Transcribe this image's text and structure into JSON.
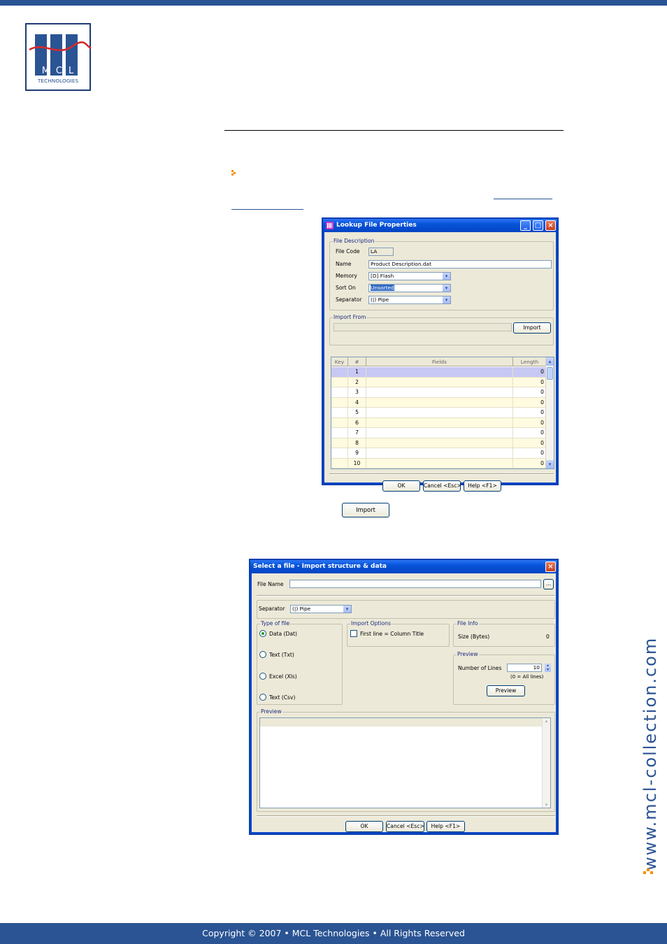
{
  "logo": {
    "letters": "MCL",
    "subtitle": "TECHNOLOGIES"
  },
  "side_url": "www.mcl-collection.com",
  "footer": {
    "text": "Copyright © 2007 • MCL Technologies • All Rights Reserved"
  },
  "inline_import_button": "Import",
  "lookup_dialog": {
    "title": "Lookup File Properties",
    "file_description_legend": "File Description",
    "labels": {
      "file_code": "File Code",
      "name": "Name",
      "memory": "Memory",
      "sort_on": "Sort On",
      "separator": "Separator"
    },
    "values": {
      "file_code": "LA",
      "name": "Product Description.dat",
      "memory": "[D] Flash",
      "sort_on": "Unsorted",
      "separator": "(|) Pipe"
    },
    "import_from_legend": "Import From",
    "import_button": "Import",
    "grid": {
      "columns": [
        "Key",
        "#",
        "Fields",
        "Length"
      ],
      "rows": [
        {
          "num": "1",
          "field": "",
          "length": "0"
        },
        {
          "num": "2",
          "field": "",
          "length": "0"
        },
        {
          "num": "3",
          "field": "",
          "length": "0"
        },
        {
          "num": "4",
          "field": "",
          "length": "0"
        },
        {
          "num": "5",
          "field": "",
          "length": "0"
        },
        {
          "num": "6",
          "field": "",
          "length": "0"
        },
        {
          "num": "7",
          "field": "",
          "length": "0"
        },
        {
          "num": "8",
          "field": "",
          "length": "0"
        },
        {
          "num": "9",
          "field": "",
          "length": "0"
        },
        {
          "num": "10",
          "field": "",
          "length": "0"
        }
      ]
    },
    "buttons": {
      "ok": "OK",
      "cancel": "Cancel <Esc>",
      "help": "Help <F1>"
    }
  },
  "select_dialog": {
    "title": "Select a file - Import structure & data",
    "file_name_label": "File Name",
    "browse_button": "...",
    "separator_label": "Separator",
    "separator_value": "(|) Pipe",
    "type_of_file_legend": "Type of file",
    "type_options": [
      "Data (Dat)",
      "Text (Txt)",
      "Excel (Xls)",
      "Text (Csv)"
    ],
    "import_options_legend": "Import Options",
    "first_line_label": "First line = Column Title",
    "file_info_legend": "File Info",
    "size_label": "Size (Bytes)",
    "size_value": "0",
    "preview_legend": "Preview",
    "number_of_lines_label": "Number of Lines",
    "number_of_lines_value": "10",
    "all_lines_hint": "(0 = All lines)",
    "preview_button": "Preview",
    "preview_area_legend": "Preview",
    "buttons": {
      "ok": "OK",
      "cancel": "Cancel <Esc>",
      "help": "Help <F1>"
    }
  }
}
